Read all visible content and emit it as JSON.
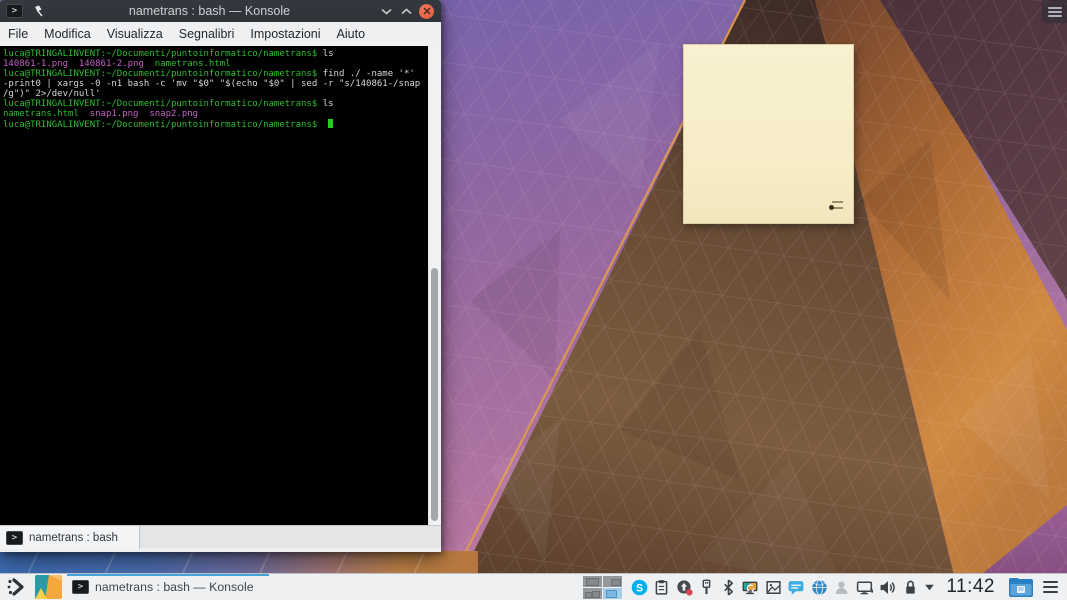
{
  "window": {
    "title": "nametrans : bash — Konsole",
    "menu": [
      "File",
      "Modifica",
      "Visualizza",
      "Segnalibri",
      "Impostazioni",
      "Aiuto"
    ],
    "tab_label": "nametrans : bash",
    "terminal": {
      "colors": {
        "green": "#2dbd2d",
        "magenta": "#c263c2",
        "default": "#d8d8d8"
      },
      "cursor_color": "#23cf23",
      "prompt": "luca@TRINGALINVENT:~/Documenti/puntoinformatico/nametrans$",
      "lines": [
        [
          {
            "t": "luca@TRINGALINVENT:~/Documenti/puntoinformatico/nametrans$",
            "c": "green"
          },
          {
            "t": " ls",
            "c": "default"
          }
        ],
        [
          {
            "t": "140861-1.png",
            "c": "magenta"
          },
          {
            "t": "  ",
            "c": "default"
          },
          {
            "t": "140861-2.png",
            "c": "magenta"
          },
          {
            "t": "  ",
            "c": "default"
          },
          {
            "t": "nametrans.html",
            "c": "green"
          }
        ],
        [
          {
            "t": "luca@TRINGALINVENT:~/Documenti/puntoinformatico/nametrans$",
            "c": "green"
          },
          {
            "t": " find ./ -name '*'",
            "c": "default"
          }
        ],
        [
          {
            "t": "-print0 | xargs -0 -n1 bash -c 'mv \"$0\" \"$(echo \"$0\" | sed -r \"s/140861-/snap",
            "c": "default"
          }
        ],
        [
          {
            "t": "/g\")\" 2>/dev/null'",
            "c": "default"
          }
        ],
        [
          {
            "t": "luca@TRINGALINVENT:~/Documenti/puntoinformatico/nametrans$",
            "c": "green"
          },
          {
            "t": " ls",
            "c": "default"
          }
        ],
        [
          {
            "t": "nametrans.html",
            "c": "green"
          },
          {
            "t": "  ",
            "c": "default"
          },
          {
            "t": "snap1.png",
            "c": "magenta"
          },
          {
            "t": "  ",
            "c": "default"
          },
          {
            "t": "snap2.png",
            "c": "magenta"
          }
        ],
        [
          {
            "t": "luca@TRINGALINVENT:~/Documenti/puntoinformatico/nametrans$",
            "c": "green"
          },
          {
            "t": " ",
            "c": "default"
          }
        ]
      ]
    }
  },
  "taskbar": {
    "task_label": "nametrans : bash — Konsole",
    "clock": "11:42",
    "tray_icons": [
      "virtual-desktop-pager",
      "skype",
      "clipboard",
      "software-update",
      "device-notifier",
      "bluetooth",
      "screen-share",
      "image-frame",
      "chat-bubble",
      "network-globe",
      "user-switch",
      "display-connect",
      "volume",
      "lock",
      "expand-chevron"
    ]
  },
  "icons": {
    "konsole_glyph": ">",
    "skype_glyph": "S"
  },
  "desktop": {
    "widgets": [
      "sticky-note",
      "desktop-toolbox"
    ]
  },
  "colors": {
    "accent": "#3daee2",
    "panel_bg": "#eef0f1",
    "titlebar_bg": "#31363b",
    "note_bg": "#f6ecc6",
    "terminal_bg": "#000000"
  }
}
